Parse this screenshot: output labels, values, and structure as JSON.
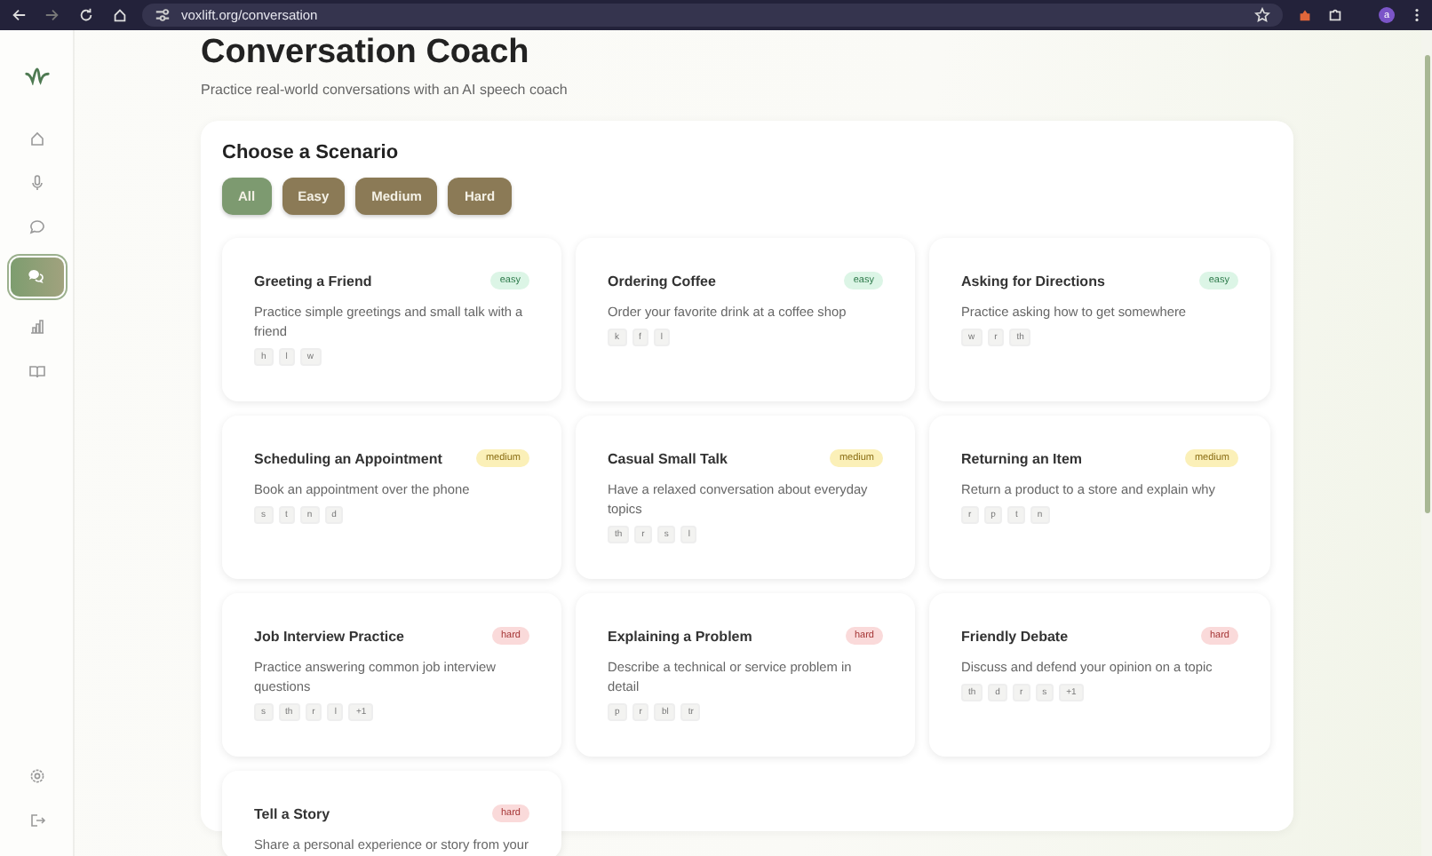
{
  "browser": {
    "url": "voxlift.org/conversation",
    "avatar": "a"
  },
  "sidebar": {
    "items": [
      {
        "selected": false
      },
      {
        "selected": false
      },
      {
        "selected": false
      },
      {
        "selected": true
      },
      {
        "selected": false
      },
      {
        "selected": false
      }
    ]
  },
  "page": {
    "title": "Conversation Coach",
    "subtitle": "Practice real-world conversations with an AI speech coach"
  },
  "panel": {
    "heading": "Choose a Scenario",
    "filters": [
      {
        "label": "All",
        "selected": true
      },
      {
        "label": "Easy",
        "selected": false
      },
      {
        "label": "Medium",
        "selected": false
      },
      {
        "label": "Hard",
        "selected": false
      }
    ],
    "scenarios": [
      {
        "title": "Greeting a Friend",
        "difficulty": "easy",
        "description": "Practice simple greetings and small talk with a friend",
        "sounds": [
          "h",
          "l",
          "w"
        ]
      },
      {
        "title": "Ordering Coffee",
        "difficulty": "easy",
        "description": "Order your favorite drink at a coffee shop",
        "sounds": [
          "k",
          "f",
          "l"
        ]
      },
      {
        "title": "Asking for Directions",
        "difficulty": "easy",
        "description": "Practice asking how to get somewhere",
        "sounds": [
          "w",
          "r",
          "th"
        ]
      },
      {
        "title": "Scheduling an Appointment",
        "difficulty": "medium",
        "description": "Book an appointment over the phone",
        "sounds": [
          "s",
          "t",
          "n",
          "d"
        ]
      },
      {
        "title": "Casual Small Talk",
        "difficulty": "medium",
        "description": "Have a relaxed conversation about everyday topics",
        "sounds": [
          "th",
          "r",
          "s",
          "l"
        ]
      },
      {
        "title": "Returning an Item",
        "difficulty": "medium",
        "description": "Return a product to a store and explain why",
        "sounds": [
          "r",
          "p",
          "t",
          "n"
        ]
      },
      {
        "title": "Job Interview Practice",
        "difficulty": "hard",
        "description": "Practice answering common job interview questions",
        "sounds": [
          "s",
          "th",
          "r",
          "l",
          "+1"
        ]
      },
      {
        "title": "Explaining a Problem",
        "difficulty": "hard",
        "description": "Describe a technical or service problem in detail",
        "sounds": [
          "p",
          "r",
          "bl",
          "tr"
        ]
      },
      {
        "title": "Friendly Debate",
        "difficulty": "hard",
        "description": "Discuss and defend your opinion on a topic",
        "sounds": [
          "th",
          "d",
          "r",
          "s",
          "+1"
        ]
      },
      {
        "title": "Tell a Story",
        "difficulty": "hard",
        "description": "Share a personal experience or story from your"
      }
    ]
  }
}
